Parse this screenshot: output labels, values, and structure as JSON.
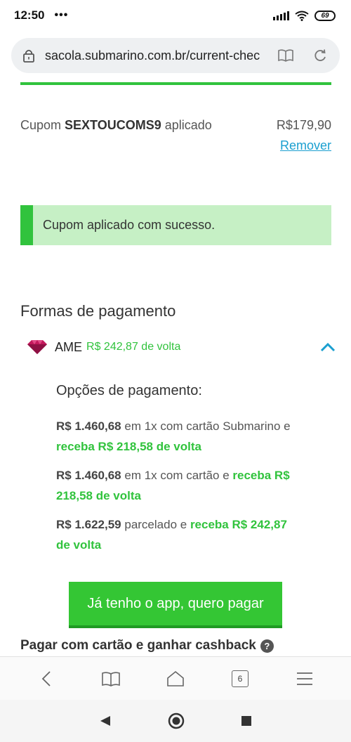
{
  "status_bar": {
    "time": "12:50",
    "dots": "•••",
    "battery": "69"
  },
  "browser": {
    "url": "sacola.submarino.com.br/current-chec",
    "tab_count": "6"
  },
  "coupon": {
    "prefix": "Cupom ",
    "code": "SEXTOUCOMS9",
    "suffix": " aplicado",
    "amount": "R$179,90",
    "remove_label": "Remover",
    "success_message": "Cupom aplicado com sucesso."
  },
  "payment": {
    "title": "Formas de pagamento",
    "ame": {
      "name": "AME",
      "cashback": "R$ 242,87 de volta"
    },
    "options_title": "Opções de pagamento:",
    "options": [
      {
        "price": "R$ 1.460,68",
        "text": " em 1x com cartão Submarino e ",
        "cashback": "receba R$ 218,58 de volta"
      },
      {
        "price": "R$ 1.460,68",
        "text": " em 1x com cartão e ",
        "cashback": "receba R$ 218,58 de volta"
      },
      {
        "price": "R$ 1.622,59",
        "text": " parcelado e ",
        "cashback": "receba R$ 242,87 de volta"
      }
    ],
    "app_button": "Já tenho o app, quero pagar",
    "card_cashback_title": "Pagar com cartão e ganhar cashback",
    "help_glyph": "?"
  },
  "colors": {
    "accent_green": "#31c33d",
    "link_blue": "#1a9fd0",
    "success_bg": "#c6f0c5",
    "ame_gem": "#c2185b"
  },
  "icons": [
    "lock-icon",
    "reader-mode-icon",
    "reload-icon",
    "ame-gem-icon",
    "chevron-up-icon",
    "back-icon",
    "bookmarks-icon",
    "home-icon",
    "tabs-icon",
    "menu-icon",
    "nav-back-icon",
    "nav-home-icon",
    "nav-recents-icon"
  ]
}
